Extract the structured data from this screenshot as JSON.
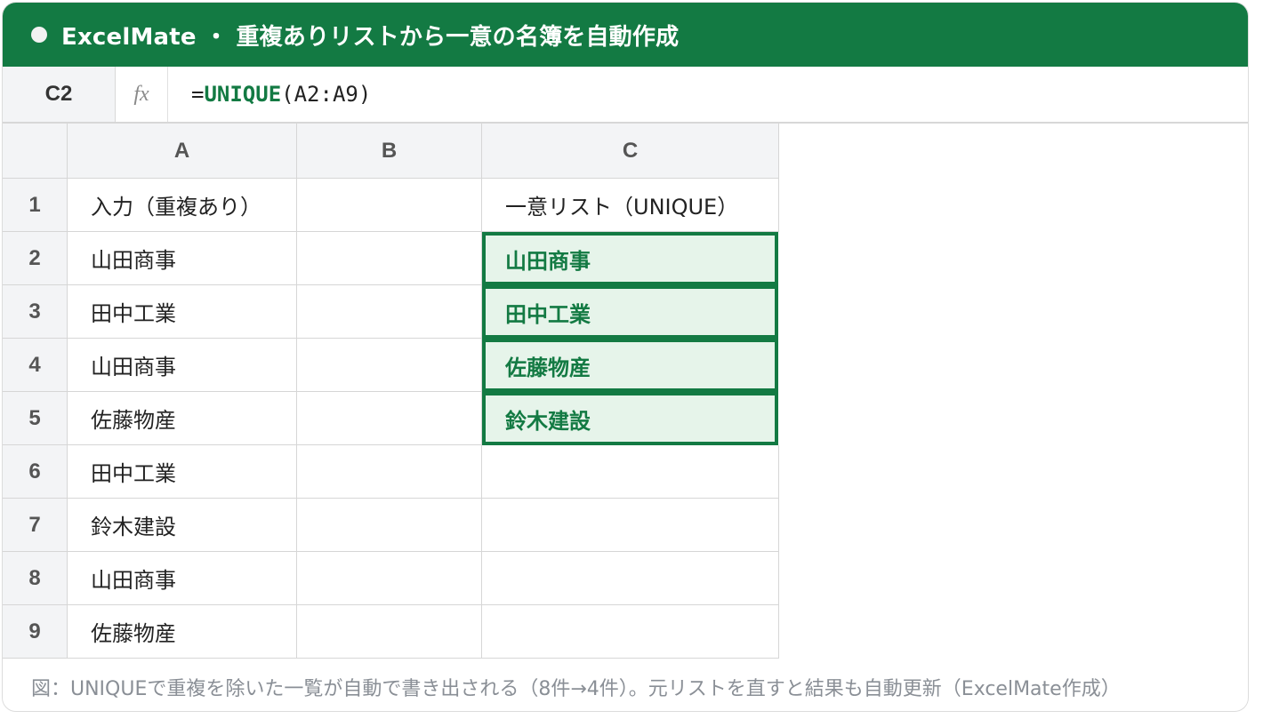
{
  "app": {
    "title": "ExcelMate ・ 重複ありリストから一意の名簿を自動作成"
  },
  "formula_bar": {
    "cell_ref": "C2",
    "fx_label": "fx",
    "formula_prefix": "=",
    "function_name": "UNIQUE",
    "formula_args": "(A2:A9)"
  },
  "columns": [
    "A",
    "B",
    "C"
  ],
  "rows": [
    {
      "num": "1",
      "a": "入力（重複あり）",
      "b": "",
      "c": "一意リスト（UNIQUE）"
    },
    {
      "num": "2",
      "a": "山田商事",
      "b": "",
      "c": "山田商事"
    },
    {
      "num": "3",
      "a": "田中工業",
      "b": "",
      "c": "田中工業"
    },
    {
      "num": "4",
      "a": "山田商事",
      "b": "",
      "c": "佐藤物産"
    },
    {
      "num": "5",
      "a": "佐藤物産",
      "b": "",
      "c": "鈴木建設"
    },
    {
      "num": "6",
      "a": "田中工業",
      "b": "",
      "c": ""
    },
    {
      "num": "7",
      "a": "鈴木建設",
      "b": "",
      "c": ""
    },
    {
      "num": "8",
      "a": "山田商事",
      "b": "",
      "c": ""
    },
    {
      "num": "9",
      "a": "佐藤物産",
      "b": "",
      "c": ""
    }
  ],
  "caption": "図：UNIQUEで重複を除いた一覧が自動で書き出される（8件→4件）。元リストを直すと結果も自動更新（ExcelMate作成）",
  "colors": {
    "accent": "#137a43",
    "spill_fill": "#e6f4ea",
    "header_fill": "#f3f4f6"
  }
}
